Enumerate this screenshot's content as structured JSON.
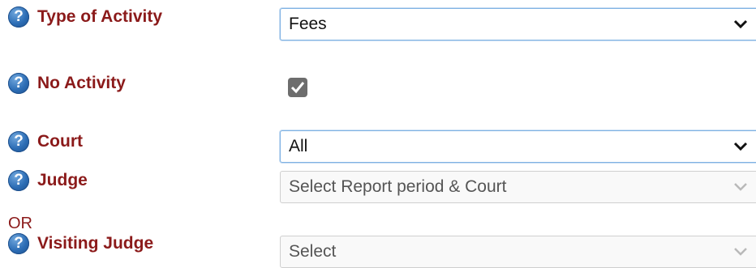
{
  "fields": [
    {
      "label": "Type of Activity",
      "value": "Fees"
    },
    {
      "label": "No Activity",
      "checked": true
    },
    {
      "label": "Court",
      "value": "All"
    },
    {
      "label": "Judge",
      "value": "Select Report period & Court",
      "disabled": true
    },
    {
      "label": "Visiting Judge",
      "value": "Select",
      "disabled": true
    }
  ],
  "or_text": "OR",
  "colors": {
    "label": "#8b1a1a",
    "help_icon": "#2c6db5",
    "checkbox": "#6d6d6d"
  },
  "icons": {
    "help": "question-circle-icon",
    "dropdown": "chevron-down-icon",
    "check": "checkmark-icon"
  }
}
